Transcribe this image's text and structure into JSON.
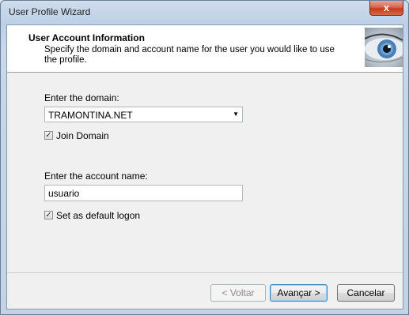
{
  "window": {
    "title": "User Profile Wizard",
    "close_glyph": "x"
  },
  "header": {
    "title": "User Account  Information",
    "subtitle": "Specify the domain and account name for the user you would like to use the profile."
  },
  "domain": {
    "label": "Enter the domain:",
    "value": "TRAMONTINA.NET"
  },
  "join_domain": {
    "label": "Join Domain",
    "checked": true
  },
  "account": {
    "label": "Enter the account name:",
    "value": "usuario"
  },
  "default_logon": {
    "label": "Set as default logon",
    "checked": true
  },
  "buttons": {
    "back": "< Voltar",
    "next": "Avançar >",
    "cancel": "Cancelar"
  }
}
